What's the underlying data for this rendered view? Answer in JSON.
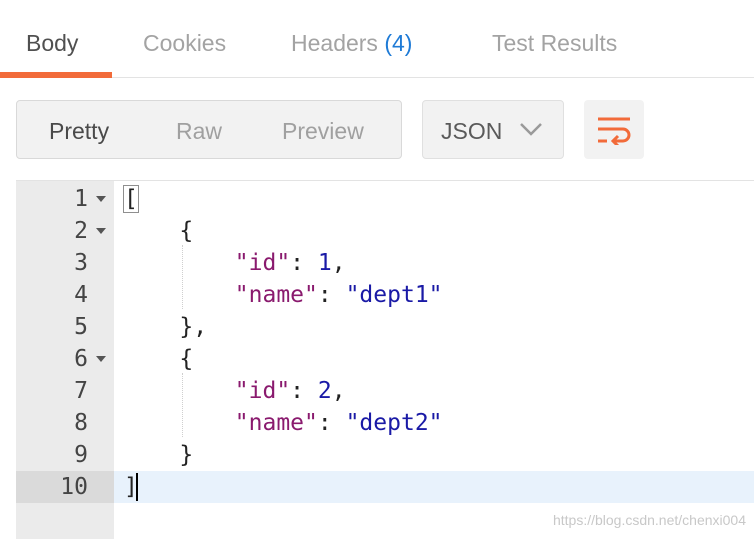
{
  "tabs": [
    {
      "label": "Body",
      "active": true
    },
    {
      "label": "Cookies",
      "active": false
    },
    {
      "label": "Headers",
      "count": "(4)",
      "active": false
    },
    {
      "label": "Test Results",
      "active": false
    }
  ],
  "view_modes": [
    "Pretty",
    "Raw",
    "Preview"
  ],
  "active_view_mode": "Pretty",
  "format_select": {
    "value": "JSON"
  },
  "wrap_button": {
    "icon": "wrap-lines-icon",
    "color": "#f26b3a"
  },
  "editor": {
    "active_line": 10,
    "lines": [
      {
        "num": "1",
        "fold": true,
        "text": "["
      },
      {
        "num": "2",
        "fold": true,
        "text": "    {"
      },
      {
        "num": "3",
        "fold": false,
        "key": "\"id\"",
        "value": "1",
        "tail": ","
      },
      {
        "num": "4",
        "fold": false,
        "key": "\"name\"",
        "value": "\"dept1\"",
        "tail": ""
      },
      {
        "num": "5",
        "fold": false,
        "text": "    },"
      },
      {
        "num": "6",
        "fold": true,
        "text": "    {"
      },
      {
        "num": "7",
        "fold": false,
        "key": "\"id\"",
        "value": "2",
        "tail": ","
      },
      {
        "num": "8",
        "fold": false,
        "key": "\"name\"",
        "value": "\"dept2\"",
        "tail": ""
      },
      {
        "num": "9",
        "fold": false,
        "text": "    }"
      },
      {
        "num": "10",
        "fold": false,
        "text": "]"
      }
    ]
  },
  "colors": {
    "accent": "#f26b3a",
    "count_blue": "#1f7bd6",
    "json_key": "#8a1a6e",
    "json_value": "#1a1aa6"
  },
  "watermark": "https://blog.csdn.net/chenxi004"
}
